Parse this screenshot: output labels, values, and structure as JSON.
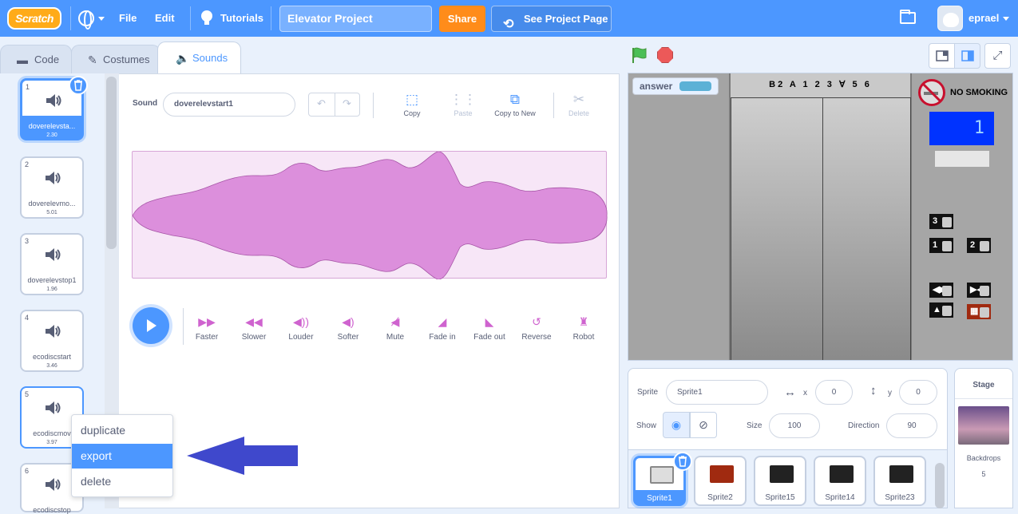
{
  "menubar": {
    "logo": "Scratch",
    "file": "File",
    "edit": "Edit",
    "tutorials": "Tutorials",
    "project_title": "Elevator Project",
    "share": "Share",
    "see_project_page": "See Project Page",
    "username": "eprael"
  },
  "tabs": [
    {
      "label": "Code",
      "icon": "code-icon"
    },
    {
      "label": "Costumes",
      "icon": "brush-icon"
    },
    {
      "label": "Sounds",
      "icon": "speaker-icon",
      "active": true
    }
  ],
  "sounds": [
    {
      "num": "1",
      "name": "doverelevsta...",
      "duration": "2.30",
      "selected": true
    },
    {
      "num": "2",
      "name": "doverelevmo...",
      "duration": "5.01"
    },
    {
      "num": "3",
      "name": "doverelevstop1",
      "duration": "1.96"
    },
    {
      "num": "4",
      "name": "ecodiscstart",
      "duration": "3.46"
    },
    {
      "num": "5",
      "name": "ecodiscmov",
      "duration": "3.97"
    },
    {
      "num": "6",
      "name": "ecodiscstop",
      "duration": ""
    }
  ],
  "context_menu": {
    "items": [
      "duplicate",
      "export",
      "delete"
    ],
    "highlighted": "export"
  },
  "editor": {
    "sound_label": "Sound",
    "sound_name": "doverelevstart1",
    "tools": [
      {
        "label": "Copy",
        "icon": "copy-icon",
        "enabled": true
      },
      {
        "label": "Paste",
        "icon": "paste-icon",
        "enabled": false
      },
      {
        "label": "Copy to New",
        "icon": "copy-to-new-icon",
        "enabled": true
      },
      {
        "label": "Delete",
        "icon": "scissors-icon",
        "enabled": false
      }
    ],
    "effects": [
      {
        "label": "Faster",
        "icon": "faster-icon"
      },
      {
        "label": "Slower",
        "icon": "slower-icon"
      },
      {
        "label": "Louder",
        "icon": "louder-icon"
      },
      {
        "label": "Softer",
        "icon": "softer-icon"
      },
      {
        "label": "Mute",
        "icon": "mute-icon"
      },
      {
        "label": "Fade in",
        "icon": "fade-in-icon"
      },
      {
        "label": "Fade out",
        "icon": "fade-out-icon"
      },
      {
        "label": "Reverse",
        "icon": "reverse-icon"
      },
      {
        "label": "Robot",
        "icon": "robot-icon"
      }
    ]
  },
  "stage": {
    "answer_label": "answer",
    "elevator_floors": "B2 A 1 2 3 ∀ 5 6",
    "no_smoking": "NO SMOKING",
    "floor_display": "1",
    "buttons": [
      "3",
      "1",
      "2"
    ]
  },
  "sprite_info": {
    "sprite_label": "Sprite",
    "sprite_name": "Sprite1",
    "x_label": "x",
    "x": "0",
    "y_label": "y",
    "y": "0",
    "show_label": "Show",
    "size_label": "Size",
    "size": "100",
    "direction_label": "Direction",
    "direction": "90"
  },
  "sprites": [
    "Sprite1",
    "Sprite2",
    "Sprite15",
    "Sprite14",
    "Sprite23"
  ],
  "stage_pane": {
    "title": "Stage",
    "backdrops_label": "Backdrops",
    "backdrops_count": "5"
  },
  "colors": {
    "menu_bg": "#4c97ff",
    "share": "#ff8c1a",
    "sound_purple": "#cf63cf",
    "wave_fill": "#dc8fdc"
  }
}
